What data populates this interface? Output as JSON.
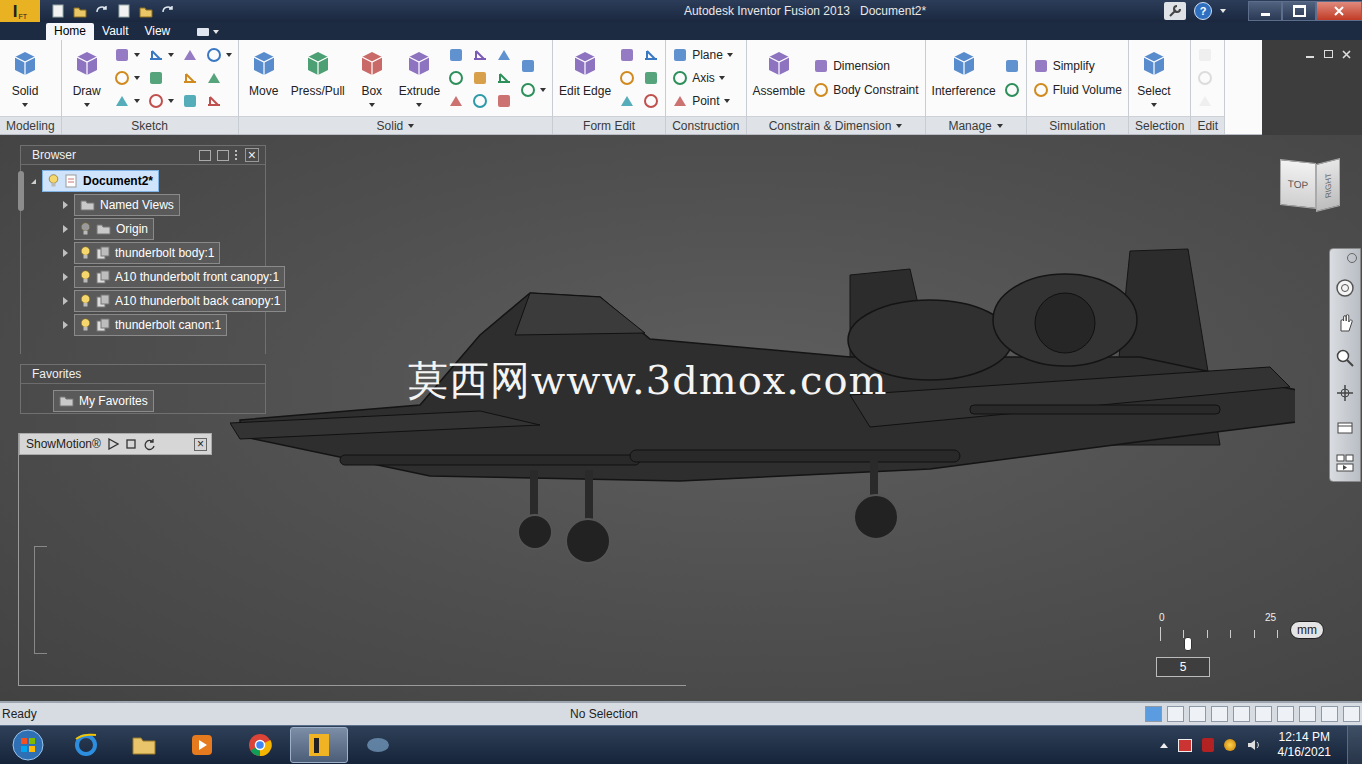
{
  "window": {
    "logo": "I",
    "logo_sub": "FT",
    "title": "Autodesk Inventor Fusion 2013",
    "document": "Document2*",
    "help": "?"
  },
  "tabs": [
    {
      "label": "Home",
      "selected": true
    },
    {
      "label": "Vault",
      "selected": false
    },
    {
      "label": "View",
      "selected": false
    }
  ],
  "ribbon": {
    "groups": [
      {
        "label": "Modeling",
        "menu": false,
        "items": [
          {
            "kind": "large",
            "label": "Solid",
            "dropdown": true,
            "disabled": false
          }
        ]
      },
      {
        "label": "Sketch",
        "menu": false,
        "items": [
          {
            "kind": "large",
            "label": "Draw",
            "dropdown": true,
            "disabled": false
          },
          {
            "kind": "stack",
            "tools": [
              {
                "kind": "icon",
                "dropdown": true,
                "disabled": false
              },
              {
                "kind": "icon",
                "dropdown": true,
                "disabled": false
              },
              {
                "kind": "icon",
                "dropdown": true,
                "disabled": false
              },
              {
                "kind": "icon",
                "dropdown": true,
                "disabled": false
              },
              {
                "kind": "icon",
                "dropdown": false,
                "disabled": false
              },
              {
                "kind": "icon",
                "dropdown": true,
                "disabled": false
              },
              {
                "kind": "icon",
                "dropdown": false,
                "disabled": false
              },
              {
                "kind": "icon",
                "dropdown": false,
                "disabled": false
              },
              {
                "kind": "icon",
                "dropdown": false,
                "disabled": false
              },
              {
                "kind": "icon",
                "dropdown": true,
                "disabled": false
              },
              {
                "kind": "icon",
                "dropdown": false,
                "disabled": false
              },
              {
                "kind": "icon",
                "dropdown": false,
                "disabled": false
              }
            ]
          }
        ]
      },
      {
        "label": "Solid",
        "menu": true,
        "items": [
          {
            "kind": "large",
            "label": "Move",
            "dropdown": false,
            "disabled": false
          },
          {
            "kind": "large",
            "label": "Press/Pull",
            "dropdown": false,
            "disabled": false
          },
          {
            "kind": "large",
            "label": "Box",
            "dropdown": true,
            "disabled": false
          },
          {
            "kind": "large",
            "label": "Extrude",
            "dropdown": true,
            "disabled": false
          },
          {
            "kind": "stack",
            "tools": [
              {
                "kind": "icon",
                "dropdown": false,
                "disabled": false
              },
              {
                "kind": "icon",
                "dropdown": false,
                "disabled": false
              },
              {
                "kind": "icon",
                "dropdown": false,
                "disabled": false
              },
              {
                "kind": "icon",
                "dropdown": false,
                "disabled": false
              },
              {
                "kind": "icon",
                "dropdown": false,
                "disabled": false
              },
              {
                "kind": "icon",
                "dropdown": false,
                "disabled": false
              },
              {
                "kind": "icon",
                "dropdown": false,
                "disabled": false
              },
              {
                "kind": "icon",
                "dropdown": false,
                "disabled": false
              },
              {
                "kind": "icon",
                "dropdown": false,
                "disabled": false
              }
            ]
          },
          {
            "kind": "stack",
            "tools": [
              {
                "kind": "icon",
                "dropdown": false,
                "disabled": false
              },
              {
                "kind": "icon",
                "dropdown": true,
                "disabled": false
              }
            ]
          }
        ]
      },
      {
        "label": "Form Edit",
        "menu": false,
        "items": [
          {
            "kind": "large",
            "label": "Edit Edge",
            "dropdown": false,
            "disabled": false
          },
          {
            "kind": "stack",
            "tools": [
              {
                "kind": "icon",
                "dropdown": false,
                "disabled": false
              },
              {
                "kind": "icon",
                "dropdown": false,
                "disabled": false
              },
              {
                "kind": "icon",
                "dropdown": false,
                "disabled": false
              },
              {
                "kind": "icon",
                "dropdown": false,
                "disabled": false
              },
              {
                "kind": "icon",
                "dropdown": false,
                "disabled": false
              },
              {
                "kind": "icon",
                "dropdown": false,
                "disabled": false
              }
            ]
          }
        ]
      },
      {
        "label": "Construction",
        "menu": false,
        "items": [
          {
            "kind": "stack",
            "tools": [
              {
                "kind": "small",
                "label": "Plane",
                "dropdown": true,
                "disabled": false
              },
              {
                "kind": "small",
                "label": "Axis",
                "dropdown": true,
                "disabled": false
              },
              {
                "kind": "small",
                "label": "Point",
                "dropdown": true,
                "disabled": false
              }
            ]
          }
        ]
      },
      {
        "label": "Constrain & Dimension",
        "menu": true,
        "items": [
          {
            "kind": "large",
            "label": "Assemble",
            "dropdown": false,
            "disabled": false
          },
          {
            "kind": "stack",
            "tools": [
              {
                "kind": "small",
                "label": "Dimension",
                "dropdown": false,
                "disabled": false
              },
              {
                "kind": "small",
                "label": "Body Constraint",
                "dropdown": false,
                "disabled": false
              }
            ]
          }
        ]
      },
      {
        "label": "Manage",
        "menu": true,
        "items": [
          {
            "kind": "large",
            "label": "Interference",
            "dropdown": false,
            "disabled": false
          },
          {
            "kind": "stack",
            "tools": [
              {
                "kind": "icon",
                "dropdown": false,
                "disabled": false
              },
              {
                "kind": "icon",
                "dropdown": false,
                "disabled": false
              }
            ]
          }
        ]
      },
      {
        "label": "Simulation",
        "menu": false,
        "items": [
          {
            "kind": "stack",
            "tools": [
              {
                "kind": "small",
                "label": "Simplify",
                "dropdown": false,
                "disabled": false
              },
              {
                "kind": "small",
                "label": "Fluid Volume",
                "dropdown": false,
                "disabled": false
              }
            ]
          }
        ]
      },
      {
        "label": "Selection",
        "menu": false,
        "items": [
          {
            "kind": "large",
            "label": "Select",
            "dropdown": true,
            "disabled": false
          }
        ]
      },
      {
        "label": "Edit",
        "menu": false,
        "items": [
          {
            "kind": "stack",
            "tools": [
              {
                "kind": "icon",
                "dropdown": false,
                "disabled": true
              },
              {
                "kind": "icon",
                "dropdown": false,
                "disabled": true
              },
              {
                "kind": "icon",
                "dropdown": false,
                "disabled": true
              }
            ]
          }
        ]
      }
    ]
  },
  "browser": {
    "title": "Browser",
    "close": "×",
    "items": [
      {
        "label": "Document2*",
        "kind": "document",
        "depth": 0,
        "expanded": true,
        "selected": true,
        "bulb": true,
        "visible": true
      },
      {
        "label": "Named Views",
        "kind": "folder",
        "depth": 1,
        "expanded": false,
        "selected": false,
        "bulb": false,
        "visible": false
      },
      {
        "label": "Origin",
        "kind": "folder",
        "depth": 1,
        "expanded": false,
        "selected": false,
        "bulb": true,
        "visible": false
      },
      {
        "label": "thunderbolt body:1",
        "kind": "component",
        "depth": 1,
        "expanded": false,
        "selected": false,
        "bulb": true,
        "visible": true
      },
      {
        "label": "A10 thunderbolt front canopy:1",
        "kind": "component",
        "depth": 1,
        "expanded": false,
        "selected": false,
        "bulb": true,
        "visible": true
      },
      {
        "label": "A10 thunderbolt back canopy:1",
        "kind": "component",
        "depth": 1,
        "expanded": false,
        "selected": false,
        "bulb": true,
        "visible": true
      },
      {
        "label": "thunderbolt canon:1",
        "kind": "component",
        "depth": 1,
        "expanded": false,
        "selected": false,
        "bulb": true,
        "visible": true
      }
    ]
  },
  "favorites": {
    "title": "Favorites",
    "items": [
      {
        "label": "My Favorites"
      }
    ]
  },
  "showmotion": {
    "title": "ShowMotion®",
    "close": "×"
  },
  "watermark": "莫西网www.3dmox.com",
  "viewcube": {
    "top": "TOP",
    "right": "RIGHT"
  },
  "scale": {
    "start": "0",
    "end": "25",
    "unit": "mm",
    "value": "5",
    "level": 0.2
  },
  "status_bar": {
    "left": "Ready",
    "center": "No Selection"
  },
  "taskbar": {
    "time": "12:14 PM",
    "date": "4/16/2021",
    "apps": [
      {
        "kind": "ie",
        "selected": false
      },
      {
        "kind": "folder",
        "selected": false
      },
      {
        "kind": "media",
        "selected": false
      },
      {
        "kind": "chrome",
        "selected": false
      },
      {
        "kind": "inventor",
        "selected": true
      },
      {
        "kind": "app",
        "selected": false
      }
    ]
  }
}
